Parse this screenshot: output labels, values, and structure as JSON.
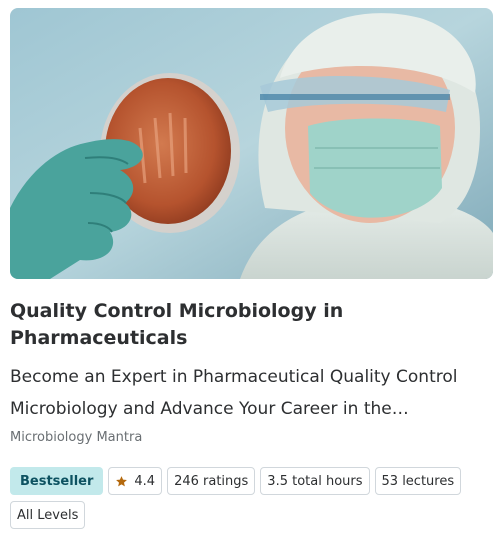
{
  "course": {
    "title": "Quality Control Microbiology in Pharmaceuticals",
    "headline": "Become an Expert in Pharmaceutical Quality Control Microbiology and Advance Your Career in the…",
    "instructor": "Microbiology Mantra",
    "badge": "Bestseller",
    "rating": "4.4",
    "ratings_count": "246 ratings",
    "total_hours": "3.5 total hours",
    "lectures": "53 lectures",
    "level": "All Levels"
  },
  "icons": {
    "rating": "star-icon"
  },
  "colors": {
    "badge_bg": "#c2e9eb",
    "badge_text": "#0d5261",
    "star": "#b4690e",
    "muted_text": "#6a6f73"
  }
}
